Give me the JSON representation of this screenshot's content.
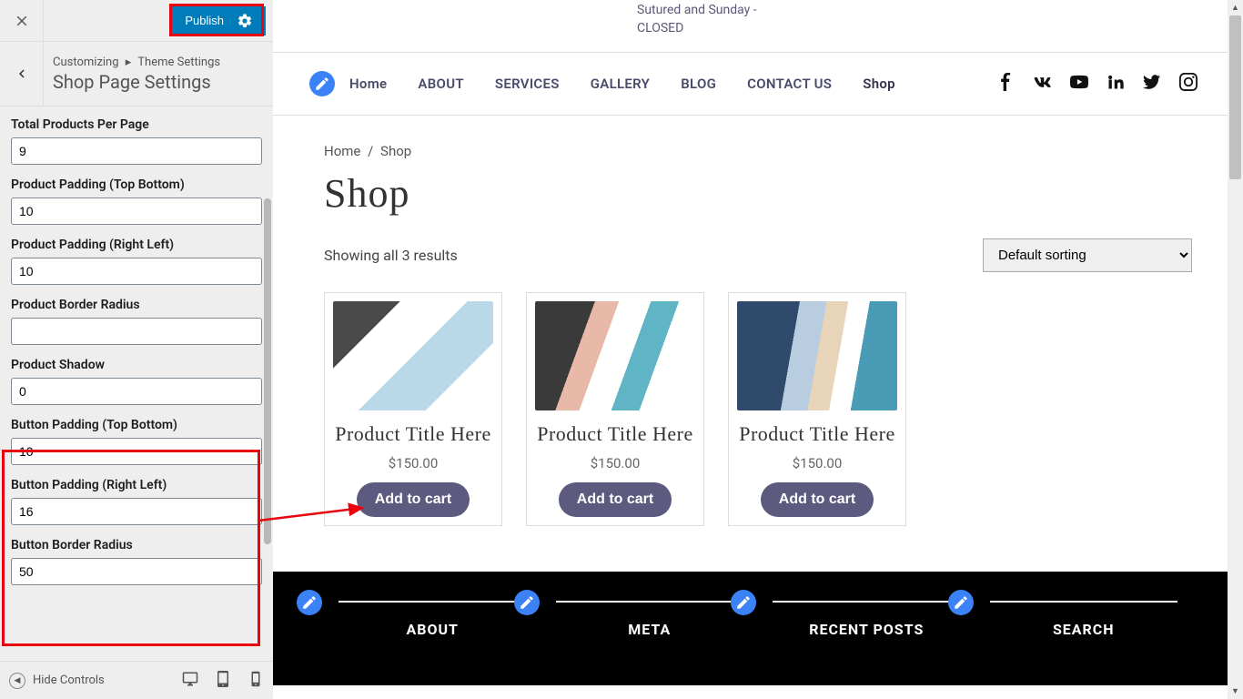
{
  "sidebar": {
    "publish_label": "Publish",
    "breadcrumb_root": "Customizing",
    "breadcrumb_leaf": "Theme Settings",
    "section_title": "Shop Page Settings",
    "fields": {
      "total_products": {
        "label": "Total Products Per Page",
        "value": "9"
      },
      "padding_tb": {
        "label": "Product Padding (Top Bottom)",
        "value": "10"
      },
      "padding_rl": {
        "label": "Product Padding (Right Left)",
        "value": "10"
      },
      "border_radius": {
        "label": "Product Border Radius",
        "value": ""
      },
      "shadow": {
        "label": "Product Shadow",
        "value": "0"
      },
      "btn_padding_tb": {
        "label": "Button Padding (Top Bottom)",
        "value": "10"
      },
      "btn_padding_rl": {
        "label": "Button Padding (Right Left)",
        "value": "16"
      },
      "btn_border_radius": {
        "label": "Button Border Radius",
        "value": "50"
      }
    },
    "hide_controls_label": "Hide Controls"
  },
  "preview": {
    "hours_line1": "Sutured and Sunday -",
    "hours_line2": "CLOSED",
    "nav": [
      "Home",
      "ABOUT",
      "SERVICES",
      "GALLERY",
      "BLOG",
      "CONTACT US",
      "Shop"
    ],
    "crumb_home": "Home",
    "crumb_current": "Shop",
    "title": "Shop",
    "results": "Showing all 3 results",
    "sort_selected": "Default sorting",
    "products": [
      {
        "title": "Product Title Here",
        "price": "$150.00",
        "btn": "Add to cart"
      },
      {
        "title": "Product Title Here",
        "price": "$150.00",
        "btn": "Add to cart"
      },
      {
        "title": "Product Title Here",
        "price": "$150.00",
        "btn": "Add to cart"
      }
    ],
    "footer_cols": [
      "ABOUT",
      "META",
      "RECENT POSTS",
      "SEARCH"
    ]
  }
}
